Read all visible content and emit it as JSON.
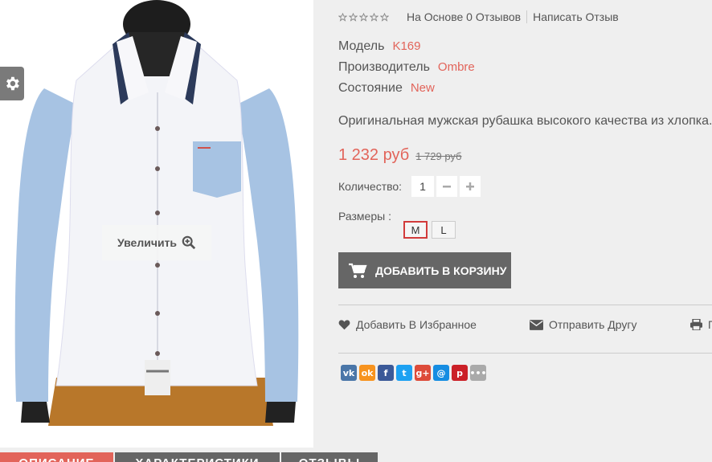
{
  "image": {
    "zoom_label": "Увеличить"
  },
  "rating": {
    "stars_filled": 0,
    "stars_total": 5,
    "reviews_text": "На Основе 0 Отзывов",
    "write_review": "Написать Отзыв"
  },
  "specs": [
    {
      "label": "Модель",
      "value": "K169"
    },
    {
      "label": "Производитель",
      "value": "Ombre"
    },
    {
      "label": "Состояние",
      "value": "New"
    }
  ],
  "description": "Оригинальная мужская рубашка высокого качества из хлопка.",
  "price": {
    "current": "1 232 руб",
    "old": "1 729 руб"
  },
  "quantity": {
    "label": "Количество:",
    "value": "1"
  },
  "sizes": {
    "label": "Размеры :",
    "options": [
      "M",
      "L"
    ],
    "selected": "M"
  },
  "cart_button": "ДОБАВИТЬ В КОРЗИНУ",
  "actions": {
    "wishlist": "Добавить В Избранное",
    "send_friend": "Отправить Другу",
    "print": "П"
  },
  "share_icons": [
    {
      "name": "vk-icon",
      "glyph": "vk",
      "color": "#4a76a8"
    },
    {
      "name": "odnoklassniki-icon",
      "glyph": "ok",
      "color": "#f7931e"
    },
    {
      "name": "facebook-icon",
      "glyph": "f",
      "color": "#3b5998"
    },
    {
      "name": "twitter-icon",
      "glyph": "t",
      "color": "#1da1f2"
    },
    {
      "name": "google-plus-icon",
      "glyph": "g+",
      "color": "#dd4b39"
    },
    {
      "name": "mailru-icon",
      "glyph": "@",
      "color": "#168de2"
    },
    {
      "name": "pinterest-icon",
      "glyph": "p",
      "color": "#cb2027"
    },
    {
      "name": "more-icon",
      "glyph": "•••",
      "color": "#aaaaaa"
    }
  ],
  "tabs": [
    "ОПИСАНИЕ",
    "ХАРАКТЕРИСТИКИ",
    "ОТЗЫВЫ"
  ],
  "colors": {
    "accent": "#e2645a",
    "button": "#666666",
    "selected_border": "#d23b3b"
  }
}
